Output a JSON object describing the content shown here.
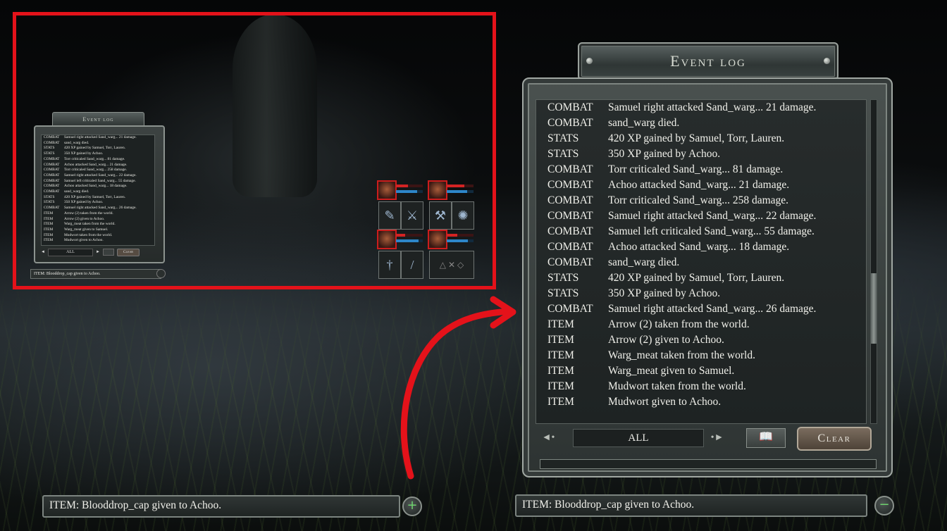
{
  "mini_log": {
    "title": "Event log",
    "entries": [
      {
        "cat": "COMBAT",
        "msg": "Samuel  right attacked Sand_warg... 21 damage."
      },
      {
        "cat": "COMBAT",
        "msg": "sand_warg died."
      },
      {
        "cat": "STATS",
        "msg": "420 XP gained by Samuel, Torr, Lauren."
      },
      {
        "cat": "STATS",
        "msg": "350 XP gained by Achoo."
      },
      {
        "cat": "COMBAT",
        "msg": "Torr  criticaled Sand_warg... 81 damage."
      },
      {
        "cat": "COMBAT",
        "msg": "Achoo  attacked Sand_warg... 21 damage."
      },
      {
        "cat": "COMBAT",
        "msg": "Torr  criticaled Sand_warg... 258 damage."
      },
      {
        "cat": "COMBAT",
        "msg": "Samuel  right attacked Sand_warg... 22 damage."
      },
      {
        "cat": "COMBAT",
        "msg": "Samuel  left criticaled Sand_warg... 55 damage."
      },
      {
        "cat": "COMBAT",
        "msg": "Achoo  attacked Sand_warg... 18 damage."
      },
      {
        "cat": "COMBAT",
        "msg": "sand_warg died."
      },
      {
        "cat": "STATS",
        "msg": "420 XP gained by Samuel, Torr, Lauren."
      },
      {
        "cat": "STATS",
        "msg": "350 XP gained by Achoo."
      },
      {
        "cat": "COMBAT",
        "msg": "Samuel  right attacked Sand_warg... 26 damage."
      },
      {
        "cat": "ITEM",
        "msg": "Arrow (2) taken from the world."
      },
      {
        "cat": "ITEM",
        "msg": "Arrow (2) given to Achoo."
      },
      {
        "cat": "ITEM",
        "msg": "Warg_meat taken from the world."
      },
      {
        "cat": "ITEM",
        "msg": "Warg_meat given to Samuel."
      },
      {
        "cat": "ITEM",
        "msg": "Mudwort taken from the world."
      },
      {
        "cat": "ITEM",
        "msg": "Mudwort given to Achoo."
      }
    ],
    "filter": "ALL",
    "clear_label": "Clear",
    "status_text": "ITEM:  Blooddrop_cap given to Achoo."
  },
  "event_log": {
    "title": "Event log",
    "entries": [
      {
        "cat": "COMBAT",
        "msg": "Samuel  right attacked Sand_warg... 21 damage."
      },
      {
        "cat": "COMBAT",
        "msg": "sand_warg died."
      },
      {
        "cat": "STATS",
        "msg": "420 XP gained by Samuel, Torr, Lauren."
      },
      {
        "cat": "STATS",
        "msg": "350 XP gained by Achoo."
      },
      {
        "cat": "COMBAT",
        "msg": "Torr  criticaled Sand_warg... 81 damage."
      },
      {
        "cat": "COMBAT",
        "msg": "Achoo  attacked Sand_warg... 21 damage."
      },
      {
        "cat": "COMBAT",
        "msg": "Torr  criticaled Sand_warg... 258 damage."
      },
      {
        "cat": "COMBAT",
        "msg": "Samuel  right attacked Sand_warg... 22 damage."
      },
      {
        "cat": "COMBAT",
        "msg": "Samuel  left criticaled Sand_warg... 55 damage."
      },
      {
        "cat": "COMBAT",
        "msg": "Achoo  attacked Sand_warg... 18 damage."
      },
      {
        "cat": "COMBAT",
        "msg": "sand_warg died."
      },
      {
        "cat": "STATS",
        "msg": "420 XP gained by Samuel, Torr, Lauren."
      },
      {
        "cat": "STATS",
        "msg": "350 XP gained by Achoo."
      },
      {
        "cat": "COMBAT",
        "msg": "Samuel  right attacked Sand_warg... 26 damage."
      },
      {
        "cat": "ITEM",
        "msg": "Arrow (2) taken from the world."
      },
      {
        "cat": "ITEM",
        "msg": "Arrow (2) given to Achoo."
      },
      {
        "cat": "ITEM",
        "msg": "Warg_meat taken from the world."
      },
      {
        "cat": "ITEM",
        "msg": "Warg_meat given to Samuel."
      },
      {
        "cat": "ITEM",
        "msg": "Mudwort taken from the world."
      },
      {
        "cat": "ITEM",
        "msg": "Mudwort given to Achoo."
      }
    ],
    "filter": "ALL",
    "clear_label": "Clear",
    "prev_icon": "arrow-left-icon",
    "next_icon": "arrow-right-icon",
    "book_icon": "book-icon"
  },
  "status_left": {
    "text": "ITEM:  Blooddrop_cap given to Achoo.",
    "button_icon": "plus-icon",
    "button_glyph": "+"
  },
  "status_right": {
    "text": "ITEM:  Blooddrop_cap given to Achoo.",
    "button_icon": "minus-icon",
    "button_glyph": "−"
  },
  "party": [
    {
      "member": "member-1",
      "health": 0.45,
      "mana": 0.8
    },
    {
      "member": "member-2",
      "health": 0.65,
      "mana": 0.75
    },
    {
      "member": "member-3",
      "health": 0.35,
      "mana": 0.85
    },
    {
      "member": "member-4",
      "health": 0.4,
      "mana": 0.8
    }
  ],
  "colors": {
    "highlight": "#e4121a",
    "health": "#d32323",
    "mana": "#2d86c9",
    "accent_green": "#6fd36f"
  }
}
